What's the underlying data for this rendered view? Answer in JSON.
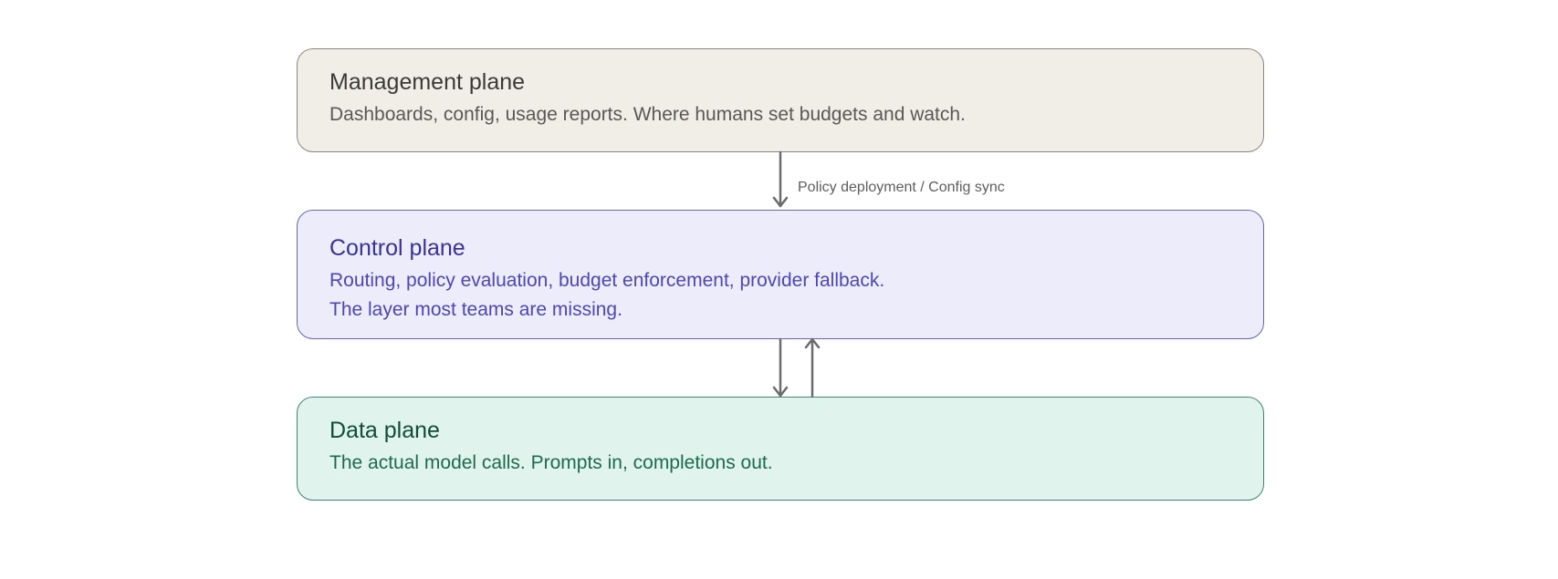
{
  "planes": {
    "management": {
      "title": "Management plane",
      "description": "Dashboards, config, usage reports. Where humans set budgets and watch."
    },
    "control": {
      "title": "Control plane",
      "description_line1": "Routing, policy evaluation, budget enforcement, provider fallback.",
      "description_line2": "The layer most teams are missing."
    },
    "data": {
      "title": "Data plane",
      "description": "The actual model calls. Prompts in, completions out."
    }
  },
  "connectors": {
    "management_to_control_label": "Policy deployment / Config sync"
  },
  "colors": {
    "arrow": "#6b6b6b",
    "management_fill": "#f1eee8",
    "control_fill": "#ececfb",
    "data_fill": "#e0f3ec"
  }
}
